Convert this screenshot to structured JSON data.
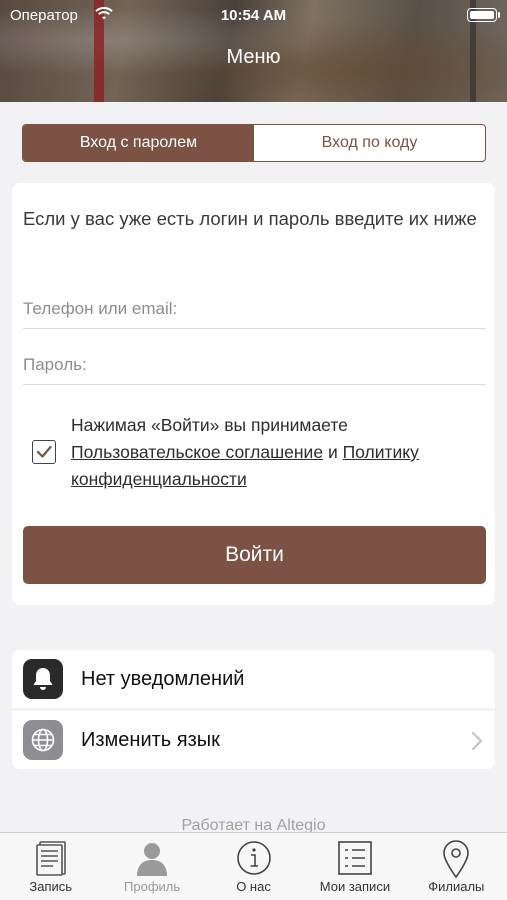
{
  "status_bar": {
    "carrier": "Оператор",
    "time": "10:54 AM"
  },
  "header": {
    "title": "Меню"
  },
  "segmented": {
    "password_login": "Вход с паролем",
    "code_login": "Вход по коду",
    "selected": "password_login"
  },
  "login": {
    "intro": "Если у вас уже есть логин и пароль введите их ниже",
    "phone_placeholder": "Телефон или email:",
    "password_placeholder": "Пароль:",
    "terms_prefix": "Нажимая «Войти» вы принимаете",
    "terms_agreement": "Пользовательское соглашение",
    "terms_and": "и",
    "terms_policy": "Политику конфиденциальности",
    "checkbox_checked": true,
    "submit": "Войти"
  },
  "settings": {
    "notifications": "Нет уведомлений",
    "language": "Изменить язык"
  },
  "powered_by": "Работает на Altegio",
  "tabbar": [
    {
      "label": "Запись",
      "icon": "document-icon"
    },
    {
      "label": "Профиль",
      "icon": "person-icon"
    },
    {
      "label": "О нас",
      "icon": "info-icon"
    },
    {
      "label": "Мои записи",
      "icon": "list-icon"
    },
    {
      "label": "Филиалы",
      "icon": "location-pin-icon"
    }
  ],
  "colors": {
    "accent": "#7b5244",
    "background": "#f2f2f4"
  }
}
